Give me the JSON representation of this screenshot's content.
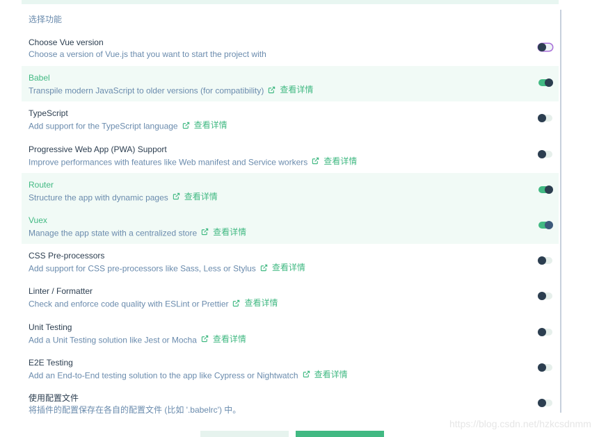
{
  "section_title": "选择功能",
  "details_label": "查看详情",
  "features": [
    {
      "name": "Choose Vue version",
      "desc": "Choose a version of Vue.js that you want to start the project with",
      "enabled": false,
      "has_link": false
    },
    {
      "name": "Babel",
      "desc": "Transpile modern JavaScript to older versions (for compatibility)",
      "enabled": true,
      "has_link": true
    },
    {
      "name": "TypeScript",
      "desc": "Add support for the TypeScript language",
      "enabled": false,
      "has_link": true
    },
    {
      "name": "Progressive Web App (PWA) Support",
      "desc": "Improve performances with features like Web manifest and Service workers",
      "enabled": false,
      "has_link": true
    },
    {
      "name": "Router",
      "desc": "Structure the app with dynamic pages",
      "enabled": true,
      "has_link": true
    },
    {
      "name": "Vuex",
      "desc": "Manage the app state with a centralized store",
      "enabled": true,
      "has_link": true
    },
    {
      "name": "CSS Pre-processors",
      "desc": "Add support for CSS pre-processors like Sass, Less or Stylus",
      "enabled": false,
      "has_link": true
    },
    {
      "name": "Linter / Formatter",
      "desc": "Check and enforce code quality with ESLint or Prettier",
      "enabled": false,
      "has_link": true
    },
    {
      "name": "Unit Testing",
      "desc": "Add a Unit Testing solution like Jest or Mocha",
      "enabled": false,
      "has_link": true
    },
    {
      "name": "E2E Testing",
      "desc": "Add an End-to-End testing solution to the app like Cypress or Nightwatch",
      "enabled": false,
      "has_link": true
    },
    {
      "name": "使用配置文件",
      "desc": "将插件的配置保存在各自的配置文件 (比如 '.babelrc') 中。",
      "enabled": false,
      "has_link": false
    }
  ],
  "watermark": "https://blog.csdn.net/hzkcsdnmm",
  "colors": {
    "accent": "#42b983",
    "text": "#2c3e50",
    "muted": "#6a8bad"
  },
  "icons": {
    "link": "external-link-icon"
  }
}
